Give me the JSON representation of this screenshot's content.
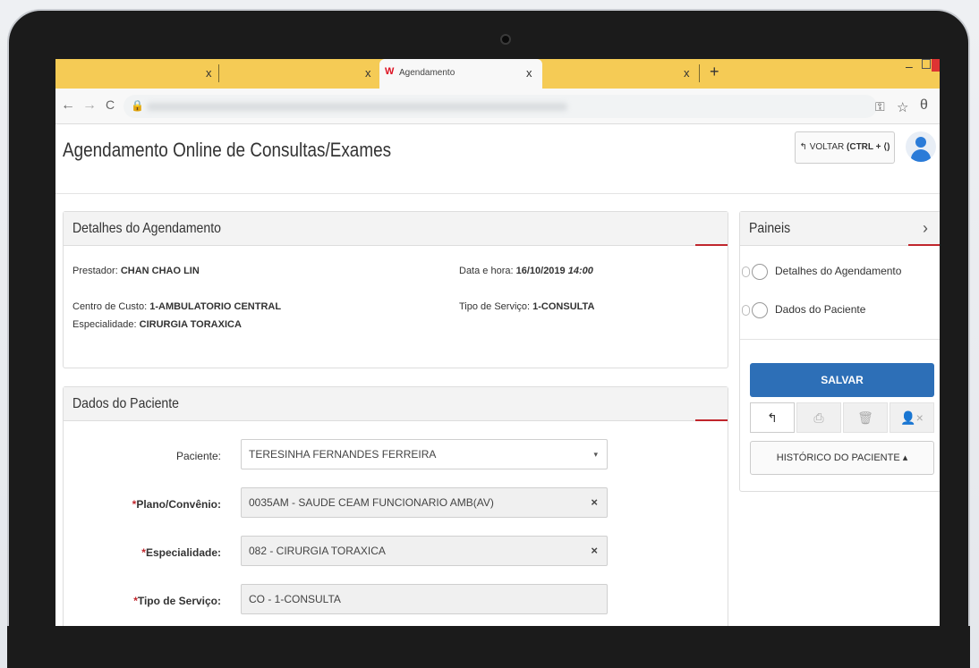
{
  "browser": {
    "tabs": [
      {
        "title": "",
        "close": "x"
      },
      {
        "title": "",
        "close": "x"
      },
      {
        "title": "Agendamento",
        "close": "x",
        "favicon": "W"
      },
      {
        "title": "",
        "close": "x"
      }
    ],
    "new_tab": "+",
    "nav_back": "←",
    "nav_forward": "→",
    "nav_reload": "C",
    "lock": "🔒",
    "key_icon": "⚿",
    "star_icon": "☆",
    "profile_icon": "θ",
    "minimize": "–"
  },
  "header": {
    "title": "Agendamento Online de Consultas/Exames",
    "back_button_icon": "↰",
    "back_button_label": "VOLTAR",
    "back_button_shortcut": "(CTRL + ⟨)"
  },
  "details_panel": {
    "title": "Detalhes do Agendamento",
    "prestador_label": "Prestador:",
    "prestador_value": "CHAN CHAO LIN",
    "data_label": "Data e hora:",
    "data_value": "16/10/2019",
    "hora_value": "14:00",
    "centro_label": "Centro de Custo:",
    "centro_value": "1-AMBULATORIO CENTRAL",
    "tipo_label": "Tipo de Serviço:",
    "tipo_value": "1-CONSULTA",
    "especialidade_label": "Especialidade:",
    "especialidade_value": "CIRURGIA TORAXICA"
  },
  "patient_panel": {
    "title": "Dados do Paciente",
    "paciente_label": "Paciente:",
    "paciente_value": "TERESINHA FERNANDES FERREIRA",
    "plano_label": "Plano/Convênio:",
    "plano_value": "0035AM - SAUDE CEAM FUNCIONARIO AMB(AV)",
    "esp_label": "Especialidade:",
    "esp_value": "082 - CIRURGIA TORAXICA",
    "tipo_label": "Tipo de Serviço:",
    "tipo_value": "CO - 1-CONSULTA",
    "required_mark": "*",
    "clear_icon": "×",
    "caret_icon": "▾"
  },
  "paineis": {
    "title": "Paineis",
    "chevron": "›",
    "items": [
      {
        "label": "Detalhes do Agendamento"
      },
      {
        "label": "Dados do Paciente"
      }
    ],
    "save_button": "SALVAR",
    "action_icons": [
      "↰",
      "⎙",
      "🗑",
      "👤×"
    ],
    "history_button": "HISTÓRICO DO PACIENTE ▴"
  }
}
